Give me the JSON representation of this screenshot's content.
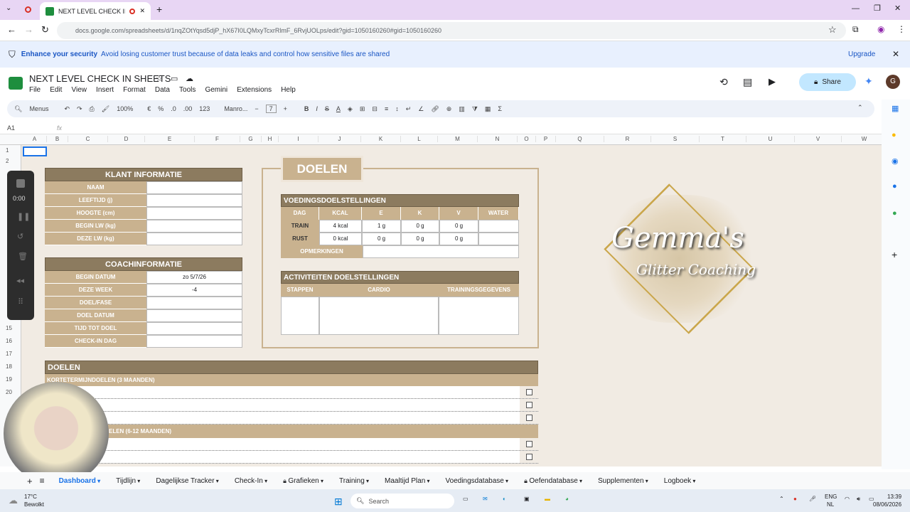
{
  "browser": {
    "tab_title": "NEXT LEVEL CHECK IN SHEETS",
    "url": "docs.google.com/spreadsheets/d/1nqZOtYqsd5djP_hX67I0LQMxyTcxrRlmF_6RvjUOLps/edit?gid=1050160260#gid=1050160260"
  },
  "banner": {
    "bold": "Enhance your security",
    "text": "Avoid losing customer trust because of data leaks and control how sensitive files are shared",
    "upgrade": "Upgrade"
  },
  "doc": {
    "title": "NEXT LEVEL CHECK IN SHEETS",
    "menus": [
      "File",
      "Edit",
      "View",
      "Insert",
      "Format",
      "Data",
      "Tools",
      "Gemini",
      "Extensions",
      "Help"
    ],
    "share": "Share",
    "avatar": "G"
  },
  "toolbar": {
    "menus": "Menus",
    "zoom": "100%",
    "currency": "€",
    "percent": "%",
    "dec_less": ".0",
    "dec_more": ".00",
    "num": "123",
    "font": "Manro...",
    "size": "7"
  },
  "cellref": "A1",
  "cols": [
    "A",
    "B",
    "C",
    "D",
    "E",
    "F",
    "G",
    "H",
    "I",
    "J",
    "K",
    "L",
    "M",
    "N",
    "O",
    "P",
    "Q",
    "R",
    "S",
    "T",
    "U",
    "V",
    "W"
  ],
  "rows": [
    "1",
    "2",
    "15",
    "16",
    "17",
    "18",
    "19",
    "20"
  ],
  "klant": {
    "title": "KLANT INFORMATIE",
    "rows": [
      "NAAM",
      "LEEFTIJD (j)",
      "HOOGTE (cm)",
      "BEGIN LW (kg)",
      "DEZE LW (kg)"
    ]
  },
  "coach": {
    "title": "COACHINFORMATIE",
    "rows": [
      {
        "l": "BEGIN DATUM",
        "v": "zo 5/7/26"
      },
      {
        "l": "DEZE WEEK",
        "v": "-4"
      },
      {
        "l": "DOEL/FASE",
        "v": ""
      },
      {
        "l": "DOEL DATUM",
        "v": ""
      },
      {
        "l": "TIJD TOT DOEL",
        "v": ""
      },
      {
        "l": "CHECK-IN DAG",
        "v": ""
      }
    ]
  },
  "doelen_box": {
    "title": "DOELEN"
  },
  "voeding": {
    "title": "VOEDINGSDOELSTELLINGEN",
    "head": [
      "DAG",
      "KCAL",
      "E",
      "K",
      "V",
      "WATER"
    ],
    "rows": [
      [
        "TRAIN",
        "4 kcal",
        "1 g",
        "0 g",
        "0 g",
        ""
      ],
      [
        "RUST",
        "0 kcal",
        "0 g",
        "0 g",
        "0 g",
        ""
      ]
    ],
    "opm": "OPMERKINGEN"
  },
  "activ": {
    "title": "ACTIVITEITEN DOELSTELLINGEN",
    "head": [
      "STAPPEN",
      "CARDIO",
      "TRAININGSGEGEVENS"
    ]
  },
  "logo": {
    "line1": "Gemma's",
    "line2": "Glitter Coaching"
  },
  "doelen": {
    "title": "DOELEN",
    "short": "KORTETERMIJNDOELEN (3 MAANDEN)",
    "long": "ELEN (6-12 MAANDEN)"
  },
  "video": {
    "time": "0:00"
  },
  "sheets": [
    "Dashboard",
    "Tijdlijn",
    "Dagelijkse Tracker",
    "Check-In",
    "Grafieken",
    "Training",
    "Maaltijd Plan",
    "Voedingsdatabase",
    "Oefendatabase",
    "Supplementen",
    "Logboek"
  ],
  "taskbar": {
    "temp": "17°C",
    "weather": "Bewolkt",
    "search": "Search",
    "lang1": "ENG",
    "lang2": "NL",
    "time": "13:39",
    "date": "08/06/2026"
  }
}
